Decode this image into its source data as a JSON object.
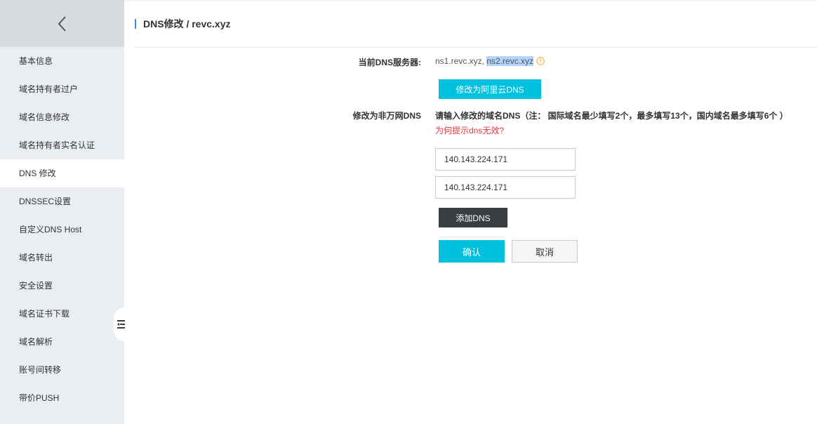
{
  "sidebar": {
    "items": [
      {
        "label": "基本信息"
      },
      {
        "label": "域名持有者过户"
      },
      {
        "label": "域名信息修改"
      },
      {
        "label": "域名持有者实名认证"
      },
      {
        "label": "DNS 修改"
      },
      {
        "label": "DNSSEC设置"
      },
      {
        "label": "自定义DNS Host"
      },
      {
        "label": "域名转出"
      },
      {
        "label": "安全设置"
      },
      {
        "label": "域名证书下载"
      },
      {
        "label": "域名解析"
      },
      {
        "label": "账号间转移"
      },
      {
        "label": "带价PUSH"
      }
    ],
    "active_index": 4
  },
  "header": {
    "title": "DNS修改 / revc.xyz"
  },
  "current_dns": {
    "label": "当前DNS服务器:",
    "server1": "ns1.revc.xyz, ",
    "server2": "ns2.revc.xyz",
    "switch_button": "修改为阿里云DNS"
  },
  "custom_dns": {
    "label": "修改为非万网DNS",
    "hint": "请输入修改的域名DNS（注： 国际域名最少填写2个，最多填写13个，国内域名最多填写6个 ）",
    "help_link": "为何提示dns无效?",
    "inputs": [
      "140.143.224.171",
      "140.143.224.171"
    ],
    "add_button": "添加DNS"
  },
  "actions": {
    "confirm": "确认",
    "cancel": "取消"
  },
  "colors": {
    "accent": "#00c1de",
    "dark_button": "#373d41",
    "link_red": "#e4393c",
    "warning": "#f5a623"
  }
}
